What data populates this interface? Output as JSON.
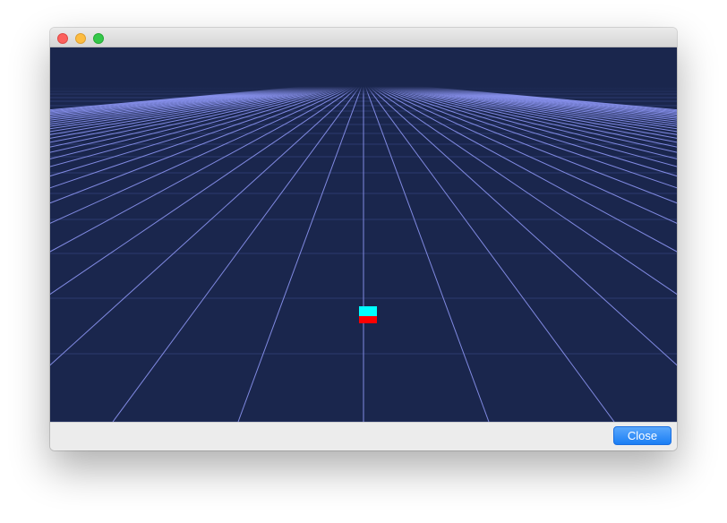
{
  "window": {
    "controls": {
      "close_icon": "close-traffic-light",
      "minimize_icon": "minimize-traffic-light",
      "zoom_icon": "zoom-traffic-light"
    }
  },
  "scene": {
    "background_color": "#1a264d",
    "grid_color": "#8c95f2",
    "object_top_color": "#00ffff",
    "object_bottom_color": "#ff0000"
  },
  "footer": {
    "close_label": "Close",
    "button_color": "#1a7ef4"
  }
}
